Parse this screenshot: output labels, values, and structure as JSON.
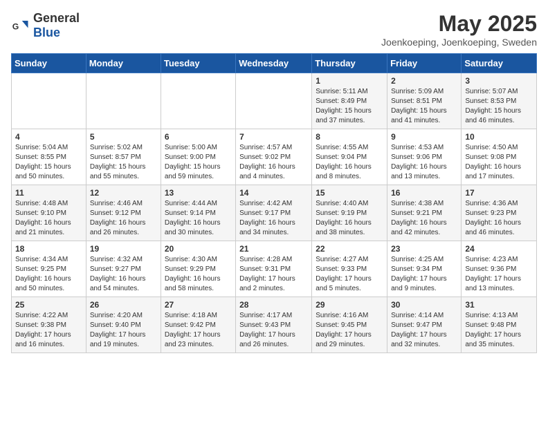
{
  "header": {
    "logo_general": "General",
    "logo_blue": "Blue",
    "month_title": "May 2025",
    "location": "Joenkoeping, Joenkoeping, Sweden"
  },
  "days_of_week": [
    "Sunday",
    "Monday",
    "Tuesday",
    "Wednesday",
    "Thursday",
    "Friday",
    "Saturday"
  ],
  "weeks": [
    [
      {
        "day": "",
        "content": ""
      },
      {
        "day": "",
        "content": ""
      },
      {
        "day": "",
        "content": ""
      },
      {
        "day": "",
        "content": ""
      },
      {
        "day": "1",
        "content": "Sunrise: 5:11 AM\nSunset: 8:49 PM\nDaylight: 15 hours and 37 minutes."
      },
      {
        "day": "2",
        "content": "Sunrise: 5:09 AM\nSunset: 8:51 PM\nDaylight: 15 hours and 41 minutes."
      },
      {
        "day": "3",
        "content": "Sunrise: 5:07 AM\nSunset: 8:53 PM\nDaylight: 15 hours and 46 minutes."
      }
    ],
    [
      {
        "day": "4",
        "content": "Sunrise: 5:04 AM\nSunset: 8:55 PM\nDaylight: 15 hours and 50 minutes."
      },
      {
        "day": "5",
        "content": "Sunrise: 5:02 AM\nSunset: 8:57 PM\nDaylight: 15 hours and 55 minutes."
      },
      {
        "day": "6",
        "content": "Sunrise: 5:00 AM\nSunset: 9:00 PM\nDaylight: 15 hours and 59 minutes."
      },
      {
        "day": "7",
        "content": "Sunrise: 4:57 AM\nSunset: 9:02 PM\nDaylight: 16 hours and 4 minutes."
      },
      {
        "day": "8",
        "content": "Sunrise: 4:55 AM\nSunset: 9:04 PM\nDaylight: 16 hours and 8 minutes."
      },
      {
        "day": "9",
        "content": "Sunrise: 4:53 AM\nSunset: 9:06 PM\nDaylight: 16 hours and 13 minutes."
      },
      {
        "day": "10",
        "content": "Sunrise: 4:50 AM\nSunset: 9:08 PM\nDaylight: 16 hours and 17 minutes."
      }
    ],
    [
      {
        "day": "11",
        "content": "Sunrise: 4:48 AM\nSunset: 9:10 PM\nDaylight: 16 hours and 21 minutes."
      },
      {
        "day": "12",
        "content": "Sunrise: 4:46 AM\nSunset: 9:12 PM\nDaylight: 16 hours and 26 minutes."
      },
      {
        "day": "13",
        "content": "Sunrise: 4:44 AM\nSunset: 9:14 PM\nDaylight: 16 hours and 30 minutes."
      },
      {
        "day": "14",
        "content": "Sunrise: 4:42 AM\nSunset: 9:17 PM\nDaylight: 16 hours and 34 minutes."
      },
      {
        "day": "15",
        "content": "Sunrise: 4:40 AM\nSunset: 9:19 PM\nDaylight: 16 hours and 38 minutes."
      },
      {
        "day": "16",
        "content": "Sunrise: 4:38 AM\nSunset: 9:21 PM\nDaylight: 16 hours and 42 minutes."
      },
      {
        "day": "17",
        "content": "Sunrise: 4:36 AM\nSunset: 9:23 PM\nDaylight: 16 hours and 46 minutes."
      }
    ],
    [
      {
        "day": "18",
        "content": "Sunrise: 4:34 AM\nSunset: 9:25 PM\nDaylight: 16 hours and 50 minutes."
      },
      {
        "day": "19",
        "content": "Sunrise: 4:32 AM\nSunset: 9:27 PM\nDaylight: 16 hours and 54 minutes."
      },
      {
        "day": "20",
        "content": "Sunrise: 4:30 AM\nSunset: 9:29 PM\nDaylight: 16 hours and 58 minutes."
      },
      {
        "day": "21",
        "content": "Sunrise: 4:28 AM\nSunset: 9:31 PM\nDaylight: 17 hours and 2 minutes."
      },
      {
        "day": "22",
        "content": "Sunrise: 4:27 AM\nSunset: 9:33 PM\nDaylight: 17 hours and 5 minutes."
      },
      {
        "day": "23",
        "content": "Sunrise: 4:25 AM\nSunset: 9:34 PM\nDaylight: 17 hours and 9 minutes."
      },
      {
        "day": "24",
        "content": "Sunrise: 4:23 AM\nSunset: 9:36 PM\nDaylight: 17 hours and 13 minutes."
      }
    ],
    [
      {
        "day": "25",
        "content": "Sunrise: 4:22 AM\nSunset: 9:38 PM\nDaylight: 17 hours and 16 minutes."
      },
      {
        "day": "26",
        "content": "Sunrise: 4:20 AM\nSunset: 9:40 PM\nDaylight: 17 hours and 19 minutes."
      },
      {
        "day": "27",
        "content": "Sunrise: 4:18 AM\nSunset: 9:42 PM\nDaylight: 17 hours and 23 minutes."
      },
      {
        "day": "28",
        "content": "Sunrise: 4:17 AM\nSunset: 9:43 PM\nDaylight: 17 hours and 26 minutes."
      },
      {
        "day": "29",
        "content": "Sunrise: 4:16 AM\nSunset: 9:45 PM\nDaylight: 17 hours and 29 minutes."
      },
      {
        "day": "30",
        "content": "Sunrise: 4:14 AM\nSunset: 9:47 PM\nDaylight: 17 hours and 32 minutes."
      },
      {
        "day": "31",
        "content": "Sunrise: 4:13 AM\nSunset: 9:48 PM\nDaylight: 17 hours and 35 minutes."
      }
    ]
  ]
}
